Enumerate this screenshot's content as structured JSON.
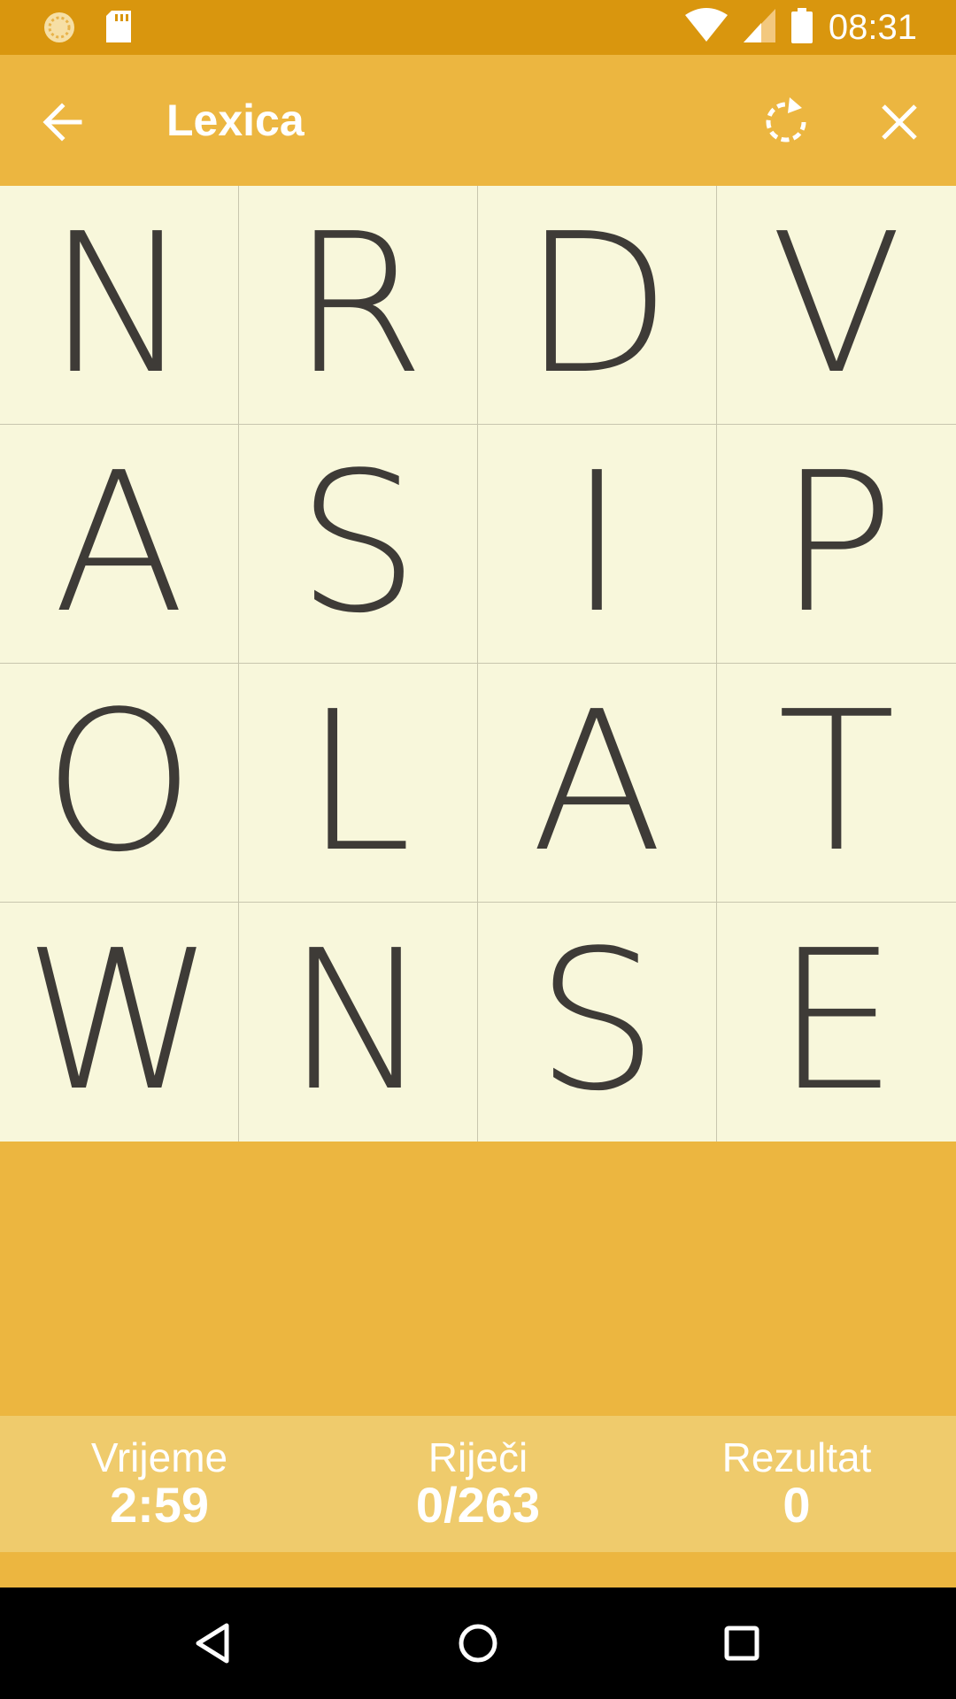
{
  "status_bar": {
    "time": "08:31",
    "icons": [
      "sync-icon",
      "sd-card-icon",
      "wifi-icon",
      "signal-icon",
      "battery-icon"
    ]
  },
  "app_bar": {
    "title": "Lexica",
    "icons": [
      "back-arrow-icon",
      "restart-icon",
      "close-icon"
    ]
  },
  "board": {
    "rows": [
      [
        "N",
        "R",
        "D",
        "V"
      ],
      [
        "A",
        "S",
        "I",
        "P"
      ],
      [
        "O",
        "L",
        "A",
        "T"
      ],
      [
        "W",
        "N",
        "S",
        "E"
      ]
    ]
  },
  "stats": {
    "time_label": "Vrijeme",
    "time_value": "2:59",
    "words_label": "Riječi",
    "words_value": "0/263",
    "score_label": "Rezultat",
    "score_value": "0"
  },
  "nav_bar": {
    "icons": [
      "nav-back-icon",
      "nav-home-icon",
      "nav-recents-icon"
    ]
  },
  "colors": {
    "status_bar": "#D9960E",
    "primary": "#ECB640",
    "tile": "#F8F7DB",
    "letter": "#3E3B37",
    "stats_bg": "#EFCB6C"
  }
}
